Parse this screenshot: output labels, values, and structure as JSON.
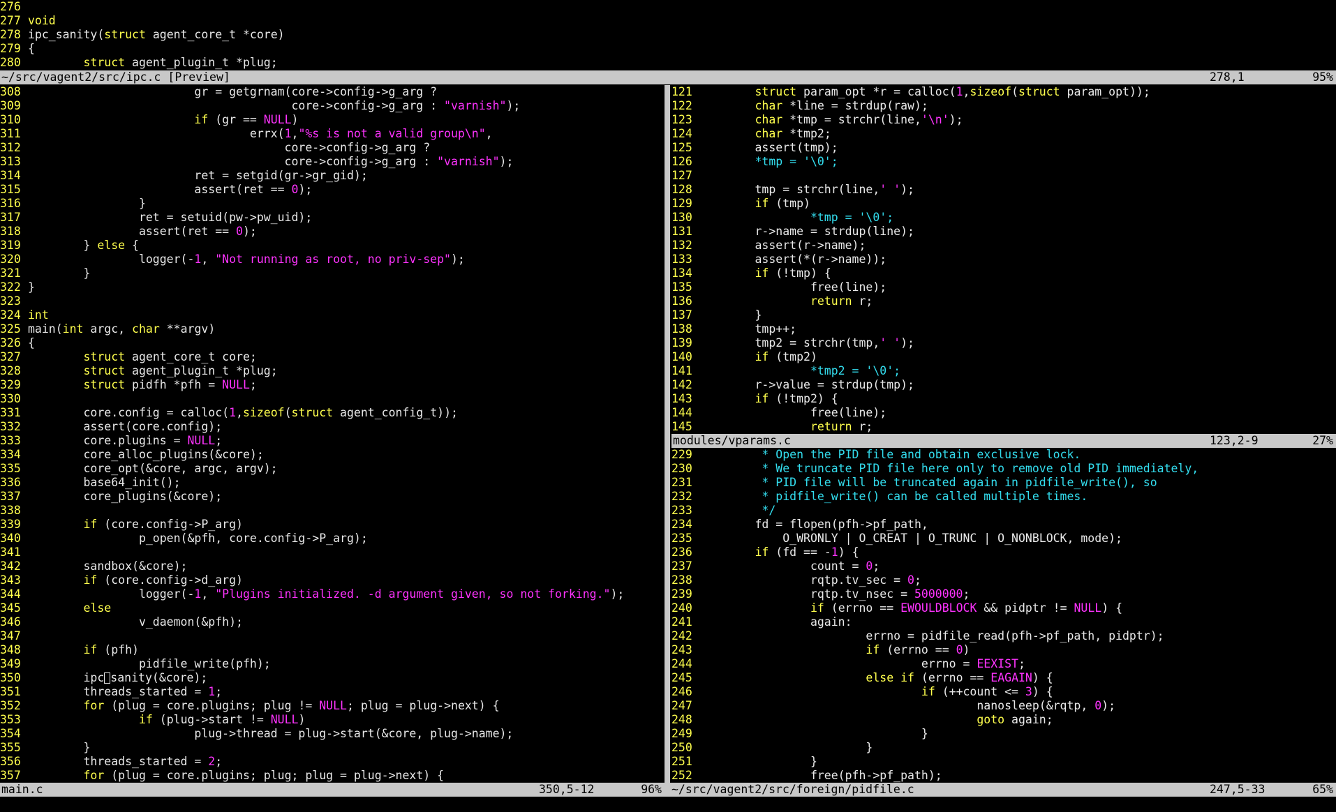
{
  "colors": {
    "background": "#000000",
    "line_number": "#ffff4d",
    "keyword": "#ffff4d",
    "string": "#ff33ff",
    "comment": "#33ddee",
    "statusbar": "#c8c8c8"
  },
  "preview": {
    "start": 276,
    "lines": [
      "",
      "void",
      "ipc_sanity(struct agent_core_t *core)",
      "{",
      "        struct agent_plugin_t *plug;"
    ],
    "status": {
      "name": "~/src/vagent2/src/ipc.c [Preview]",
      "position": "278,1",
      "percent": "95%"
    }
  },
  "main": {
    "start": 308,
    "lines": [
      "                        gr = getgrnam(core->config->g_arg ?",
      "                                      core->config->g_arg : \"varnish\");",
      "                        if (gr == NULL)",
      "                                errx(1,\"%s is not a valid group\\n\",",
      "                                     core->config->g_arg ?",
      "                                     core->config->g_arg : \"varnish\");",
      "                        ret = setgid(gr->gr_gid);",
      "                        assert(ret == 0);",
      "                }",
      "                ret = setuid(pw->pw_uid);",
      "                assert(ret == 0);",
      "        } else {",
      "                logger(-1, \"Not running as root, no priv-sep\");",
      "        }",
      "}",
      "",
      "int",
      "main(int argc, char **argv)",
      "{",
      "        struct agent_core_t core;",
      "        struct agent_plugin_t *plug;",
      "        struct pidfh *pfh = NULL;",
      "",
      "        core.config = calloc(1,sizeof(struct agent_config_t));",
      "        assert(core.config);",
      "        core.plugins = NULL;",
      "        core_alloc_plugins(&core);",
      "        core_opt(&core, argc, argv);",
      "        base64_init();",
      "        core_plugins(&core);",
      "",
      "        if (core.config->P_arg)",
      "                p_open(&pfh, core.config->P_arg);",
      "",
      "        sandbox(&core);",
      "        if (core.config->d_arg)",
      "                logger(-1, \"Plugins initialized. -d argument given, so not forking.\");",
      "        else",
      "                v_daemon(&pfh);",
      "",
      "        if (pfh)",
      "                pidfile_write(pfh);",
      "        ipc_sanity(&core);",
      "        threads_started = 1;",
      "        for (plug = core.plugins; plug != NULL; plug = plug->next) {",
      "                if (plug->start != NULL)",
      "                        plug->thread = plug->start(&core, plug->name);",
      "        }",
      "        threads_started = 2;",
      "        for (plug = core.plugins; plug; plug = plug->next) {"
    ],
    "status": {
      "name": "main.c",
      "position": "350,5-12",
      "percent": "96%"
    }
  },
  "vparams": {
    "start": 121,
    "lines": [
      "        struct param_opt *r = calloc(1,sizeof(struct param_opt));",
      "        char *line = strdup(raw);",
      "        char *tmp = strchr(line,'\\n');",
      "        char *tmp2;",
      "        assert(tmp);",
      "        *tmp = '\\0';",
      "",
      "        tmp = strchr(line,' ');",
      "        if (tmp)",
      "                *tmp = '\\0';",
      "        r->name = strdup(line);",
      "        assert(r->name);",
      "        assert(*(r->name));",
      "        if (!tmp) {",
      "                free(line);",
      "                return r;",
      "        }",
      "        tmp++;",
      "        tmp2 = strchr(tmp,' ');",
      "        if (tmp2)",
      "                *tmp2 = '\\0';",
      "        r->value = strdup(tmp);",
      "        if (!tmp2) {",
      "                free(line);",
      "                return r;"
    ],
    "status": {
      "name": "modules/vparams.c",
      "position": "123,2-9",
      "percent": "27%"
    }
  },
  "pidfile": {
    "start": 229,
    "lines": [
      "         * Open the PID file and obtain exclusive lock.",
      "         * We truncate PID file here only to remove old PID immediately,",
      "         * PID file will be truncated again in pidfile_write(), so",
      "         * pidfile_write() can be called multiple times.",
      "         */",
      "        fd = flopen(pfh->pf_path,",
      "            O_WRONLY | O_CREAT | O_TRUNC | O_NONBLOCK, mode);",
      "        if (fd == -1) {",
      "                count = 0;",
      "                rqtp.tv_sec = 0;",
      "                rqtp.tv_nsec = 5000000;",
      "                if (errno == EWOULDBLOCK && pidptr != NULL) {",
      "                again:",
      "                        errno = pidfile_read(pfh->pf_path, pidptr);",
      "                        if (errno == 0)",
      "                                errno = EEXIST;",
      "                        else if (errno == EAGAIN) {",
      "                                if (++count <= 3) {",
      "                                        nanosleep(&rqtp, 0);",
      "                                        goto again;",
      "                                }",
      "                        }",
      "                }",
      "                free(pfh->pf_path);"
    ],
    "status": {
      "name": "~/src/vagent2/src/foreign/pidfile.c",
      "position": "247,5-33",
      "percent": "65%"
    }
  }
}
